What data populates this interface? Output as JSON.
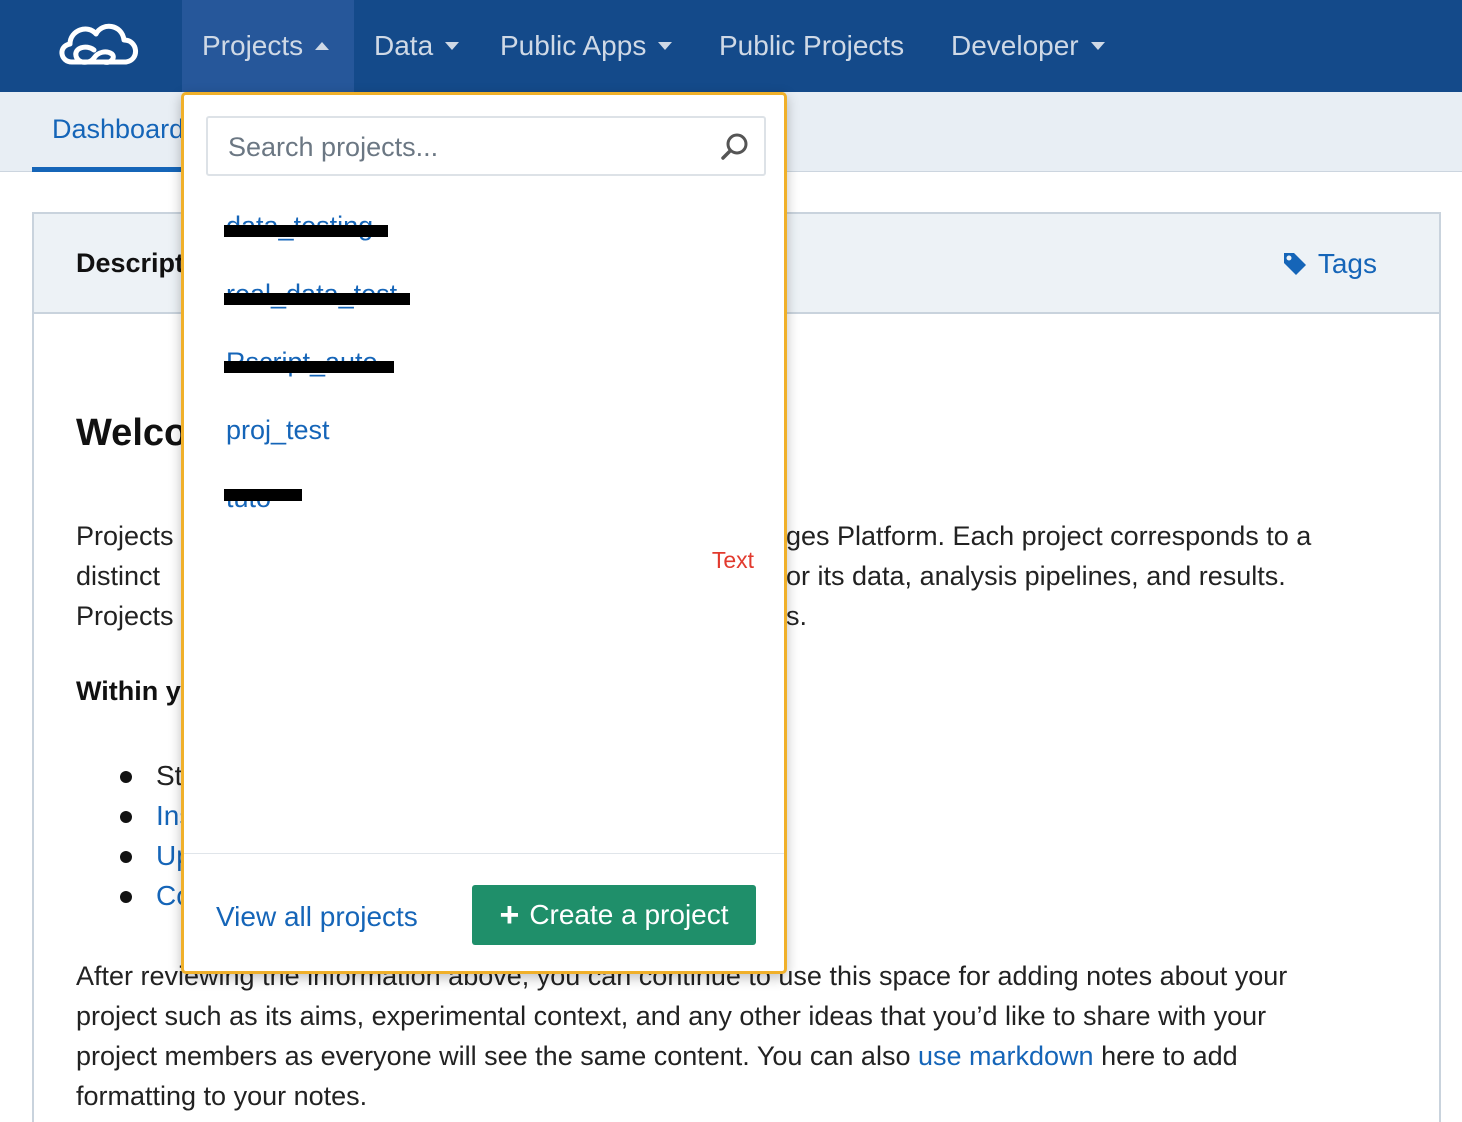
{
  "nav": {
    "items": [
      {
        "label": "Projects",
        "caret": "up",
        "active": true
      },
      {
        "label": "Data",
        "caret": "down"
      },
      {
        "label": "Public Apps",
        "caret": "down"
      },
      {
        "label": "Public Projects"
      },
      {
        "label": "Developer",
        "caret": "down"
      }
    ],
    "logo_icon": "cloud-logo-icon"
  },
  "subnav": {
    "tab_label": "Dashboard"
  },
  "card": {
    "header_title": "Description",
    "tags_label": "Tags",
    "welcome_heading": "Welco",
    "para1": [
      {
        "left": "Projects",
        "right": "ges Platform. Each project corresponds to a"
      },
      {
        "left": "distinct",
        "right": "or its data, analysis pipelines, and results."
      },
      {
        "left": "Projects",
        "right": "s."
      }
    ],
    "within_heading": "Within y",
    "bullets": [
      "St",
      "Ins",
      "Up",
      "Co"
    ],
    "para2_lines": [
      "After reviewing the information above, you can continue to use this space for adding notes about your",
      "project such as its aims, experimental context, and any other ideas that you’d like to share with your",
      "project members as everyone will see the same content. You can also "
    ],
    "para2_link": "use markdown",
    "para2_after": " here to add",
    "para2_last": "formatting to your notes."
  },
  "dropdown": {
    "search_placeholder": "Search projects...",
    "projects": [
      "data_testing",
      "real_data_test",
      "Rscript_auto",
      "proj_test",
      "tuto"
    ],
    "hint_text": "Text",
    "view_all_label": "View all projects",
    "create_label": "Create a project"
  },
  "colors": {
    "nav_bg": "#144a8a",
    "link": "#1565b8",
    "create_button": "#1f8f6a",
    "dropdown_border": "#f0b02a"
  }
}
